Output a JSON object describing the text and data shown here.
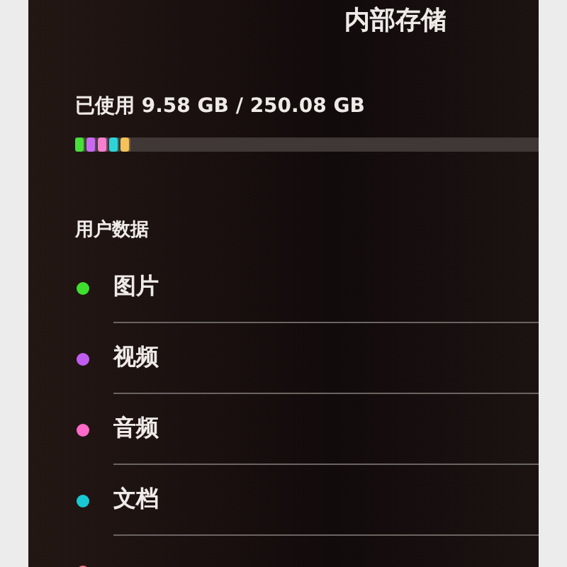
{
  "title": "内部存储",
  "usage": {
    "text": "已使用 9.58 GB / 250.08 GB",
    "segments": [
      {
        "color": "#4ade3a"
      },
      {
        "color": "#c86af0"
      },
      {
        "color": "#f77fd0"
      },
      {
        "color": "#2ed3d8"
      },
      {
        "color": "#f5c25a"
      }
    ]
  },
  "section": "用户数据",
  "items": [
    {
      "label": "图片",
      "color": "#3ee02e"
    },
    {
      "label": "视频",
      "color": "#c15cf0"
    },
    {
      "label": "音频",
      "color": "#ff6ac8"
    },
    {
      "label": "文档",
      "color": "#18c8d2"
    },
    {
      "color": "#ff6a8a"
    }
  ]
}
